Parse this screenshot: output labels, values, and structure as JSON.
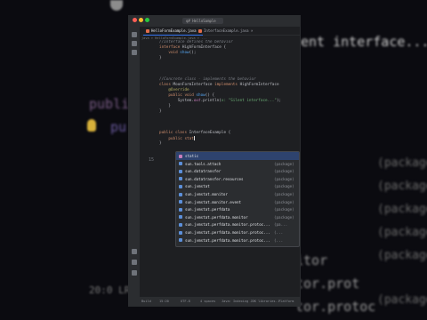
{
  "background": {
    "left_code_1": "public",
    "left_code_2": "pu",
    "right_code": "ent interface...\");",
    "package_labels": [
      "(package)",
      "(package)",
      "(package)",
      "(package)",
      "(package)",
      "(package)"
    ],
    "bottom_lines": [
      "itor",
      "tor.prot",
      "tor.protoc"
    ],
    "bottom_bar_text": "20:0 LR"
  },
  "window": {
    "title_search": "q# HelloSample",
    "tab_active": "HelloFormExample.java",
    "tab_active_close": "×",
    "tab_second": "InterfaceExample.java ×",
    "breadcrumb": "java > HelloFormExample.java > ..."
  },
  "code_lines": [
    {
      "ln": "",
      "parts": [
        [
          "cm",
          "//Interface defines the behavior"
        ]
      ]
    },
    {
      "ln": "",
      "parts": [
        [
          "kw",
          "interface "
        ],
        [
          "ty",
          "HighFormInterface {"
        ]
      ]
    },
    {
      "ln": "",
      "parts": [
        [
          "ty",
          "    "
        ],
        [
          "kw",
          "void "
        ],
        [
          "fn",
          "show"
        ],
        [
          "ty",
          "();"
        ]
      ]
    },
    {
      "ln": "",
      "parts": [
        [
          "ty",
          "}"
        ]
      ]
    },
    {
      "ln": "",
      "parts": [
        [
          "ty",
          ""
        ]
      ]
    },
    {
      "ln": "",
      "parts": [
        [
          "cm",
          "//Concrete class - implements the behavior"
        ]
      ]
    },
    {
      "ln": "",
      "parts": [
        [
          "kw",
          "class "
        ],
        [
          "ty",
          "MoonFormInterface "
        ],
        [
          "kw",
          "implements "
        ],
        [
          "ty",
          "HighFormInterface"
        ]
      ]
    },
    {
      "ln": "",
      "parts": [
        [
          "an",
          "    @Override"
        ]
      ]
    },
    {
      "ln": "",
      "parts": [
        [
          "kw",
          "    public void "
        ],
        [
          "fn",
          "show"
        ],
        [
          "ty",
          "() {"
        ]
      ]
    },
    {
      "ln": "",
      "parts": [
        [
          "ty",
          "        System."
        ],
        [
          "sf",
          "out"
        ],
        [
          "ty",
          ".println("
        ],
        [
          "st",
          "x: \"Silent interface...\""
        ],
        [
          "ty",
          ");"
        ]
      ]
    },
    {
      "ln": "",
      "parts": [
        [
          "ty",
          "    }"
        ]
      ]
    },
    {
      "ln": "",
      "parts": [
        [
          "ty",
          "}"
        ]
      ]
    },
    {
      "ln": "",
      "parts": [
        [
          "ty",
          ""
        ]
      ]
    },
    {
      "ln": "",
      "parts": [
        [
          "kw",
          "public class "
        ],
        [
          "ty",
          "InterfaceExample { "
        ]
      ]
    },
    {
      "ln": "15",
      "parts": [
        [
          "kw",
          "    public "
        ],
        [
          "kw",
          "stat"
        ]
      ]
    },
    {
      "ln": "",
      "parts": [
        [
          "ty",
          "}"
        ]
      ]
    }
  ],
  "completion": [
    {
      "name": "static",
      "type": ""
    },
    {
      "name": "sun.tools.attach",
      "type": "(package)"
    },
    {
      "name": "sun.datatransfer",
      "type": "(package)"
    },
    {
      "name": "sun.datatransfer.resources",
      "type": "(package)"
    },
    {
      "name": "sun.jvmstat",
      "type": "(package)"
    },
    {
      "name": "sun.jvmstat.monitor",
      "type": "(package)"
    },
    {
      "name": "sun.jvmstat.monitor.event",
      "type": "(package)"
    },
    {
      "name": "sun.jvmstat.perfdata",
      "type": "(package)"
    },
    {
      "name": "sun.jvmstat.perfdata.monitor",
      "type": "(package)"
    },
    {
      "name": "sun.jvmstat.perfdata.monitor.protoc...",
      "type": "(pa..."
    },
    {
      "name": "sun.jvmstat.perfdata.monitor.protoc...",
      "type": "(..."
    },
    {
      "name": "sun.jvmstat.perfdata.monitor.protoc...",
      "type": "(..."
    }
  ],
  "status": {
    "left": "Build",
    "pos": "15:20",
    "encoding": "UTF-8",
    "indent": "4 spaces",
    "msg": "Java: Indexing JDK libraries...",
    "right": "Platform"
  }
}
